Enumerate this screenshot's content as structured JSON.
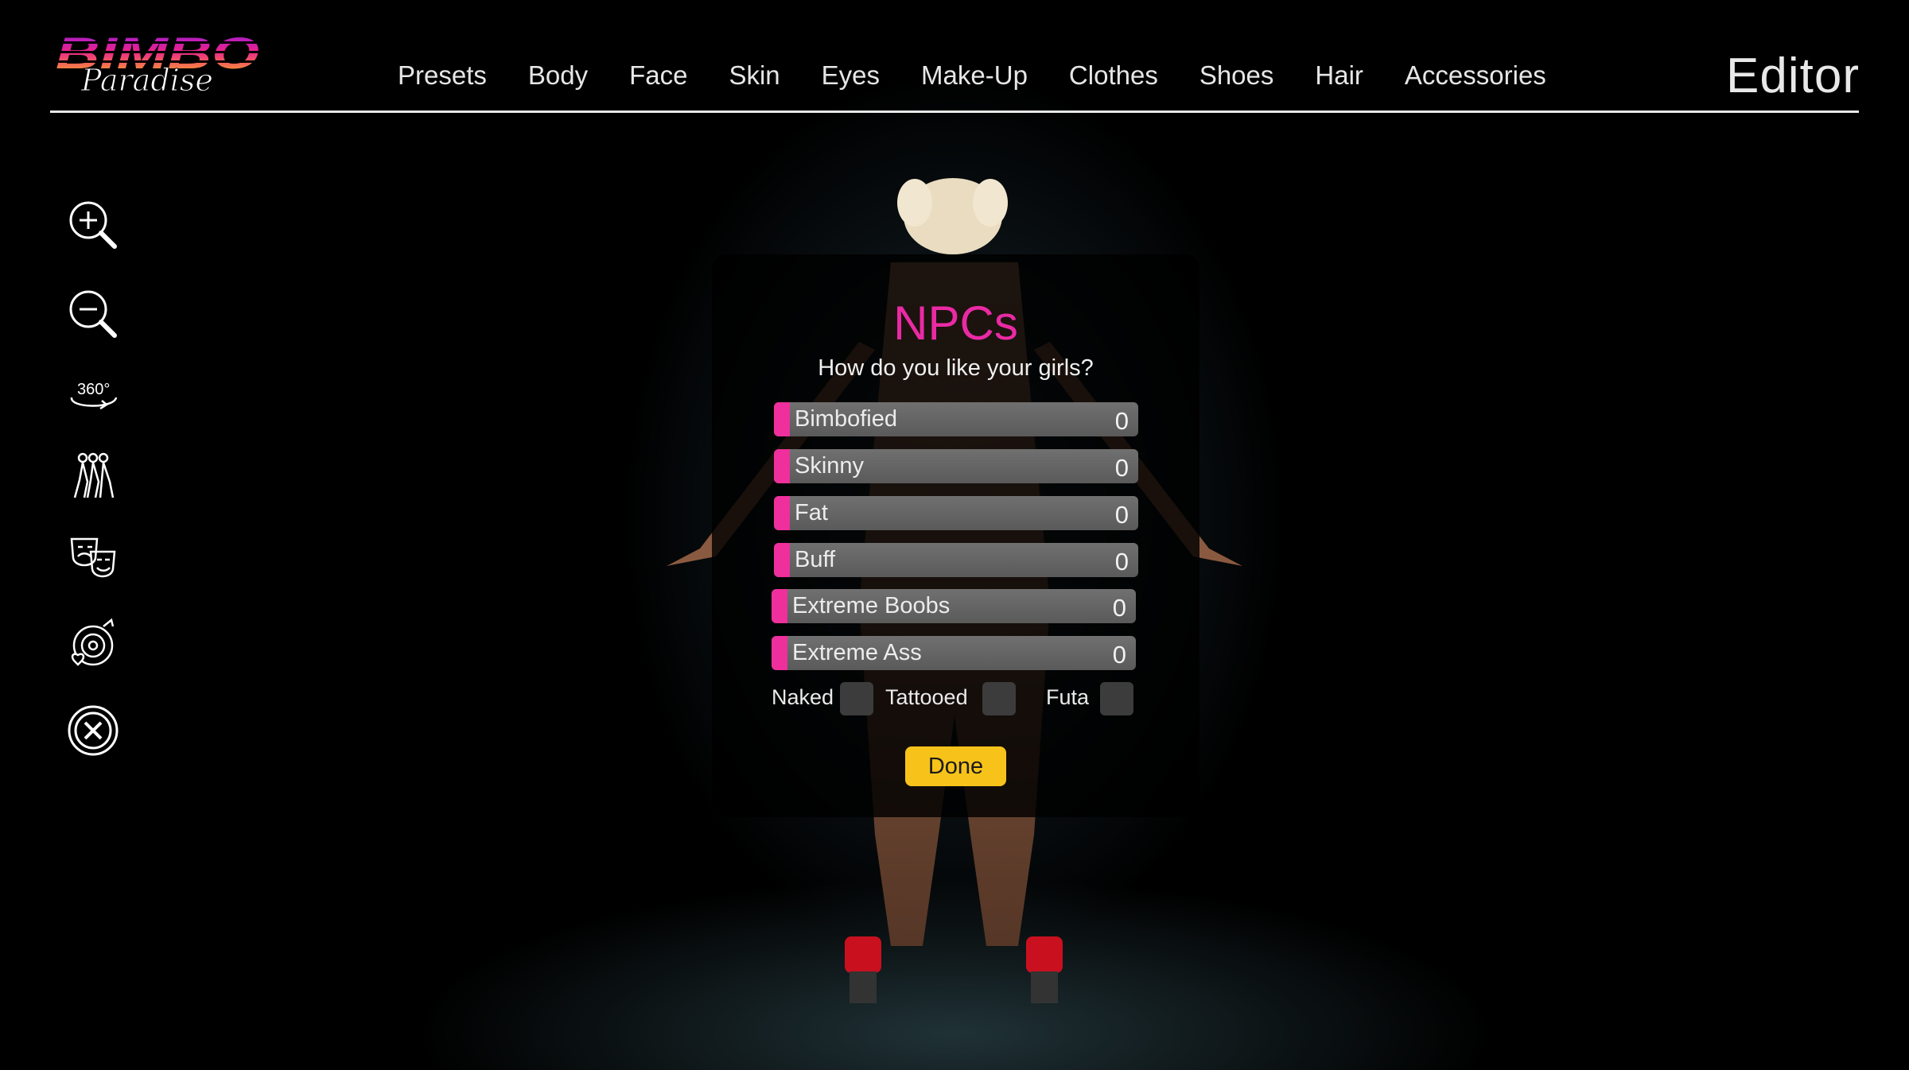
{
  "logo": {
    "word": "BIMBO",
    "script": "Paradise"
  },
  "nav": {
    "items": [
      "Presets",
      "Body",
      "Face",
      "Skin",
      "Eyes",
      "Make-Up",
      "Clothes",
      "Shoes",
      "Hair",
      "Accessories"
    ]
  },
  "editor_title": "Editor",
  "toolbar": {
    "icons": [
      "zoom-in-icon",
      "zoom-out-icon",
      "rotate-360-icon",
      "poses-icon",
      "expressions-icon",
      "music-icon",
      "close-icon"
    ],
    "rotate_label": "360°"
  },
  "dialog": {
    "title": "NPCs",
    "subtitle": "How do you like your girls?",
    "sliders": [
      {
        "label": "Bimbofied",
        "value": "0"
      },
      {
        "label": "Skinny",
        "value": "0"
      },
      {
        "label": "Fat",
        "value": "0"
      },
      {
        "label": "Buff",
        "value": "0"
      },
      {
        "label": "Extreme Boobs",
        "value": "0"
      },
      {
        "label": "Extreme Ass",
        "value": "0"
      }
    ],
    "toggles": [
      {
        "label": "Naked",
        "checked": false
      },
      {
        "label": "Tattooed",
        "checked": false
      },
      {
        "label": "Futa",
        "checked": false
      }
    ],
    "done_label": "Done"
  },
  "colors": {
    "accent_pink": "#ea2aa4",
    "slider_fill": "#ef2f9c",
    "done_button": "#f7c31a",
    "slider_track": "#666666"
  }
}
